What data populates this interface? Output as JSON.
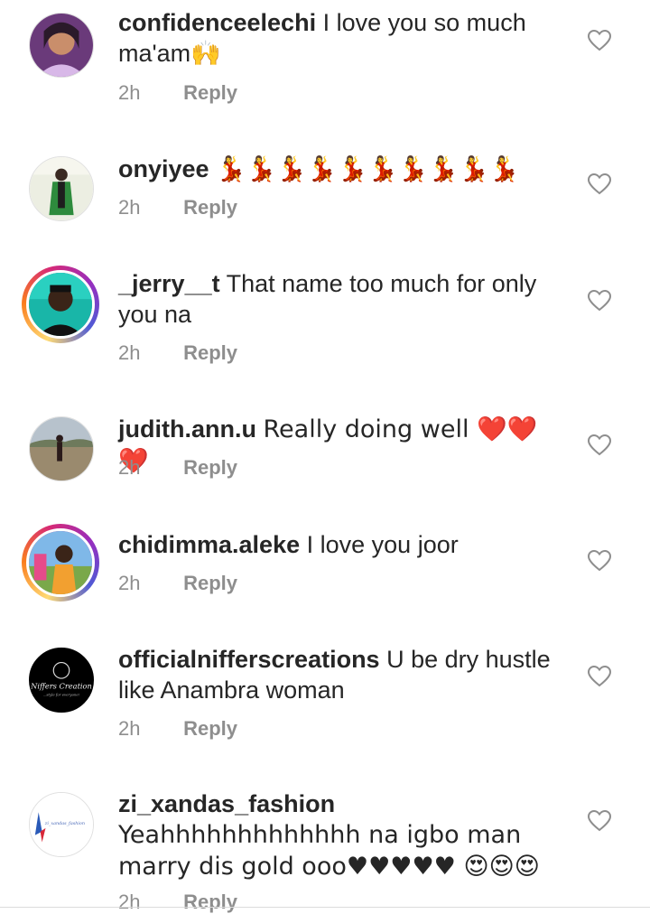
{
  "comments": [
    {
      "username": "confidenceelechi",
      "text": "I love you so much ma'am🙌",
      "time": "2h",
      "reply": "Reply"
    },
    {
      "username": "onyiyee",
      "text": "💃💃💃💃💃💃💃💃💃💃",
      "time": "2h",
      "reply": "Reply"
    },
    {
      "username": "_jerry__t",
      "text": "That name too much for only you na",
      "time": "2h",
      "reply": "Reply"
    },
    {
      "username": "judith.ann.u",
      "text": "Really doing well ❤️❤️❤️",
      "time": "2h",
      "reply": "Reply"
    },
    {
      "username": "chidimma.aleke",
      "text": "I love you joor",
      "time": "2h",
      "reply": "Reply"
    },
    {
      "username": "officialnifferscreations",
      "text": "U be dry hustle like Anambra woman",
      "time": "2h",
      "reply": "Reply"
    },
    {
      "username": "zi_xandas_fashion",
      "text": "Yeahhhhhhhhhhhhh na igbo man marry dis gold ooo♥♥♥♥♥ 😍😍😍",
      "time": "2h",
      "reply": "Reply"
    }
  ],
  "logo_text": {
    "nifferscreations": "Niffers Creation",
    "nifferscreations_tagline": "...style for everyone!",
    "xandas": "zi_xandas_fashion"
  },
  "colors": {
    "username": "#262626",
    "meta": "#8e8e8e",
    "heart_red": "#e0245e"
  }
}
